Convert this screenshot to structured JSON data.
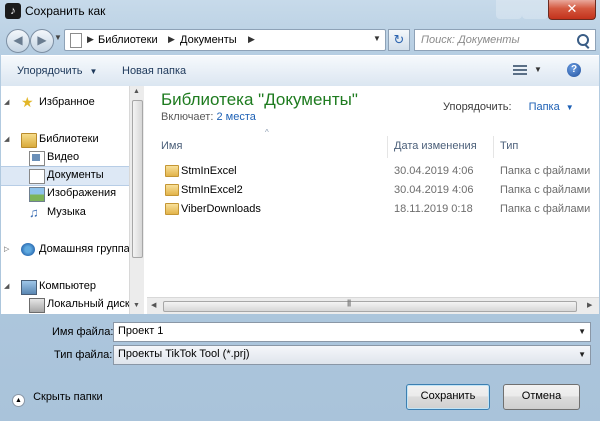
{
  "window": {
    "title": "Сохранить как",
    "app_icon": "tiktok-tool-icon",
    "close_label": "✕"
  },
  "address_bar": {
    "segments": [
      "Библиотеки",
      "Документы"
    ]
  },
  "search": {
    "placeholder": "Поиск: Документы"
  },
  "toolbar": {
    "organize_label": "Упорядочить",
    "new_folder_label": "Новая папка",
    "help_label": "?"
  },
  "sidebar": {
    "items": [
      {
        "label": "Избранное",
        "icon": "star-icon"
      },
      {
        "label": "Библиотеки",
        "icon": "libraries-icon"
      },
      {
        "label": "Видео",
        "icon": "video-icon"
      },
      {
        "label": "Документы",
        "icon": "documents-icon",
        "selected": true
      },
      {
        "label": "Изображения",
        "icon": "pictures-icon"
      },
      {
        "label": "Музыка",
        "icon": "music-icon"
      },
      {
        "label": "Домашняя группа",
        "icon": "homegroup-icon"
      },
      {
        "label": "Компьютер",
        "icon": "computer-icon"
      },
      {
        "label": "Локальный диск",
        "icon": "disk-icon"
      }
    ]
  },
  "library": {
    "title": "Библиотека \"Документы\"",
    "includes_label": "Включает:",
    "includes_link": "2 места",
    "arrange_label": "Упорядочить:",
    "arrange_value": "Папка"
  },
  "columns": {
    "name": "Имя",
    "date": "Дата изменения",
    "type": "Тип"
  },
  "files": [
    {
      "name": "StmInExcel",
      "date": "30.04.2019 4:06",
      "type": "Папка с файлами"
    },
    {
      "name": "StmInExcel2",
      "date": "30.04.2019 4:06",
      "type": "Папка с файлами"
    },
    {
      "name": "ViberDownloads",
      "date": "18.11.2019 0:18",
      "type": "Папка с файлами"
    }
  ],
  "form": {
    "filename_label": "Имя файла:",
    "filename_value": "Проект 1",
    "filetype_label": "Тип файла:",
    "filetype_value": "Проекты TikTok Tool (*.prj)"
  },
  "footer": {
    "hide_folders_label": "Скрыть папки",
    "save_label": "Сохранить",
    "cancel_label": "Отмена"
  }
}
